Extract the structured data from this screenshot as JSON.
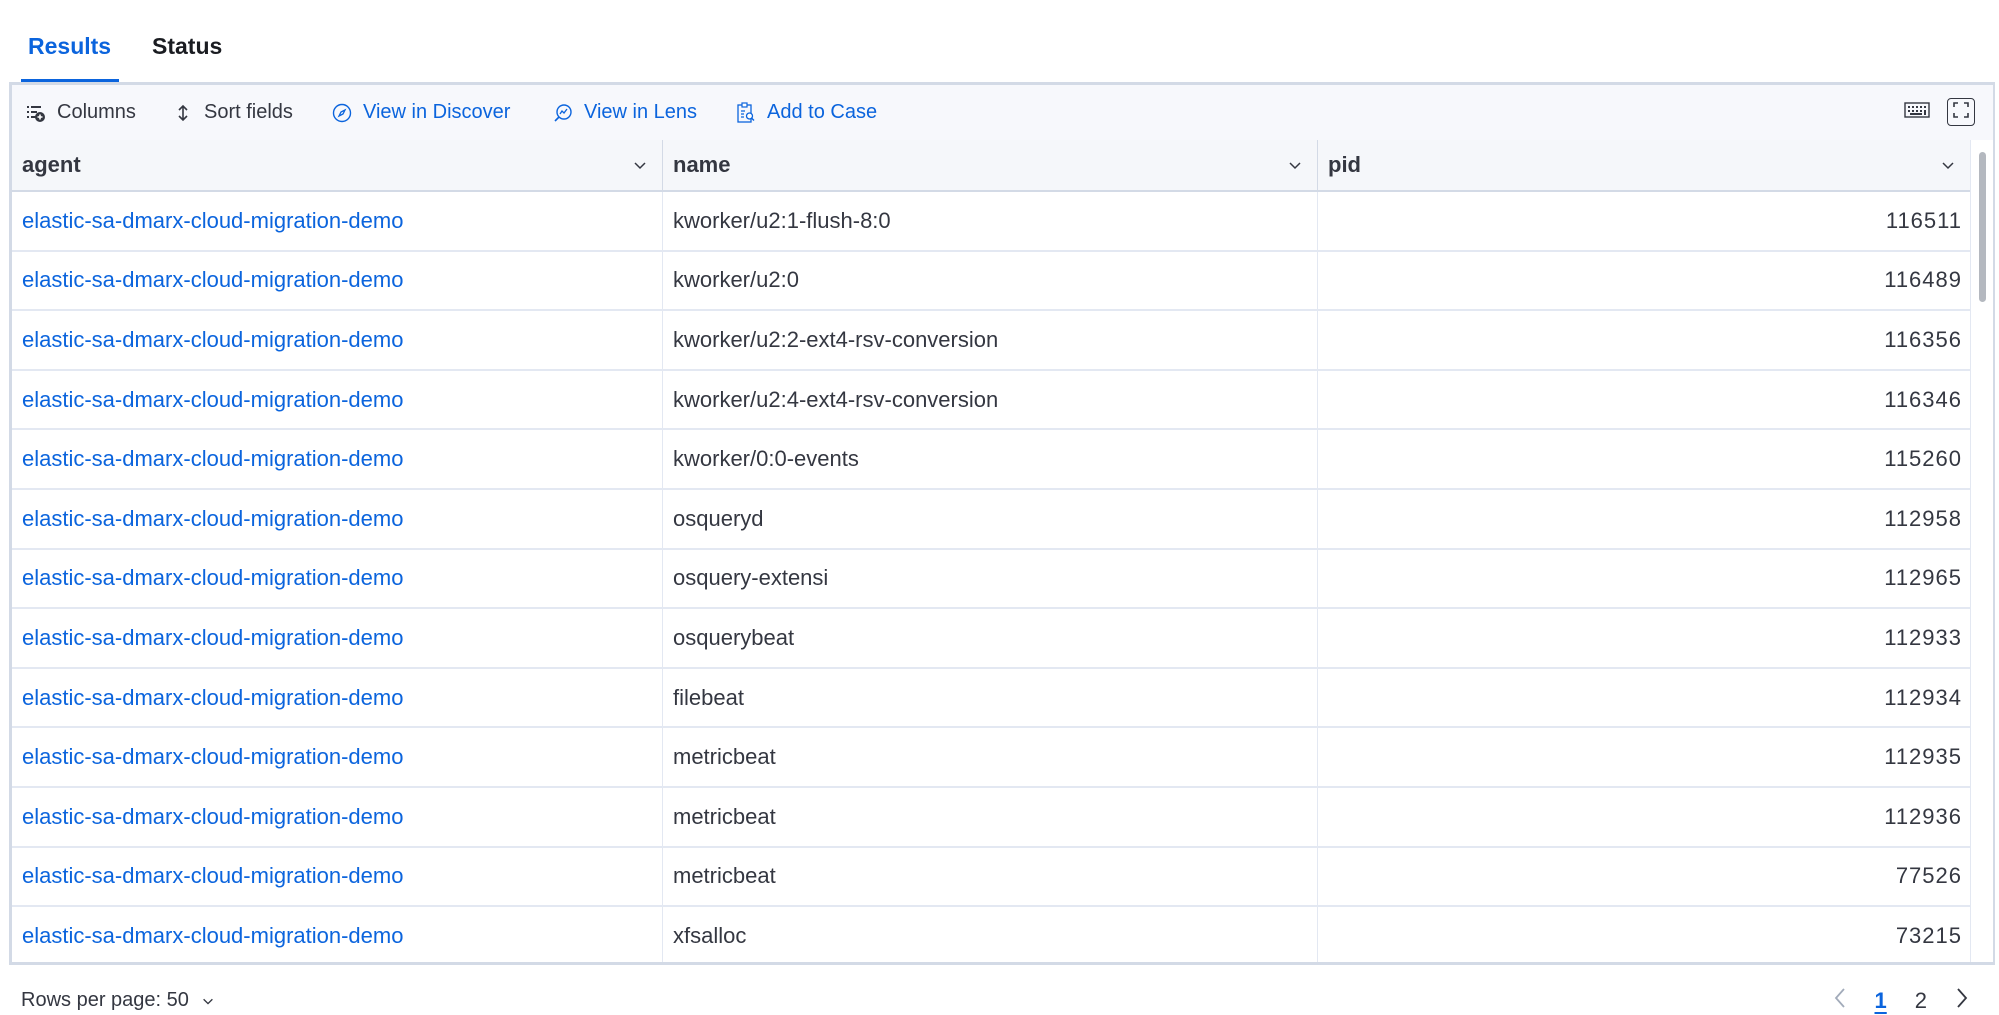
{
  "tabs": [
    {
      "label": "Results",
      "active": true
    },
    {
      "label": "Status",
      "active": false
    }
  ],
  "toolbar": {
    "columns_label": "Columns",
    "sort_fields_label": "Sort fields",
    "view_in_discover_label": "View in Discover",
    "view_in_lens_label": "View in Lens",
    "add_to_case_label": "Add to Case",
    "icons": {
      "columns": "columns-icon",
      "sort": "sort-icon",
      "discover": "compass-icon",
      "lens": "lens-icon",
      "case": "clipboard-icon",
      "keyboard": "keyboard-icon",
      "fullscreen": "fullscreen-icon"
    }
  },
  "columns": [
    {
      "key": "agent",
      "label": "agent"
    },
    {
      "key": "name",
      "label": "name"
    },
    {
      "key": "pid",
      "label": "pid"
    }
  ],
  "rows": [
    {
      "agent": "elastic-sa-dmarx-cloud-migration-demo",
      "name": "kworker/u2:1-flush-8:0",
      "pid": "116511"
    },
    {
      "agent": "elastic-sa-dmarx-cloud-migration-demo",
      "name": "kworker/u2:0",
      "pid": "116489"
    },
    {
      "agent": "elastic-sa-dmarx-cloud-migration-demo",
      "name": "kworker/u2:2-ext4-rsv-conversion",
      "pid": "116356"
    },
    {
      "agent": "elastic-sa-dmarx-cloud-migration-demo",
      "name": "kworker/u2:4-ext4-rsv-conversion",
      "pid": "116346"
    },
    {
      "agent": "elastic-sa-dmarx-cloud-migration-demo",
      "name": "kworker/0:0-events",
      "pid": "115260"
    },
    {
      "agent": "elastic-sa-dmarx-cloud-migration-demo",
      "name": "osqueryd",
      "pid": "112958"
    },
    {
      "agent": "elastic-sa-dmarx-cloud-migration-demo",
      "name": "osquery-extensi",
      "pid": "112965"
    },
    {
      "agent": "elastic-sa-dmarx-cloud-migration-demo",
      "name": "osquerybeat",
      "pid": "112933"
    },
    {
      "agent": "elastic-sa-dmarx-cloud-migration-demo",
      "name": "filebeat",
      "pid": "112934"
    },
    {
      "agent": "elastic-sa-dmarx-cloud-migration-demo",
      "name": "metricbeat",
      "pid": "112935"
    },
    {
      "agent": "elastic-sa-dmarx-cloud-migration-demo",
      "name": "metricbeat",
      "pid": "112936"
    },
    {
      "agent": "elastic-sa-dmarx-cloud-migration-demo",
      "name": "metricbeat",
      "pid": "77526"
    },
    {
      "agent": "elastic-sa-dmarx-cloud-migration-demo",
      "name": "xfsalloc",
      "pid": "73215"
    }
  ],
  "pagination": {
    "rows_per_page_label": "Rows per page: 50",
    "pages": [
      "1",
      "2"
    ],
    "current_page": "1"
  },
  "colors": {
    "accent": "#0b64dd",
    "text": "#343741",
    "border": "#d3dae6",
    "header_bg": "#f5f7fa",
    "toolbar_bg": "#f7f8fc"
  }
}
